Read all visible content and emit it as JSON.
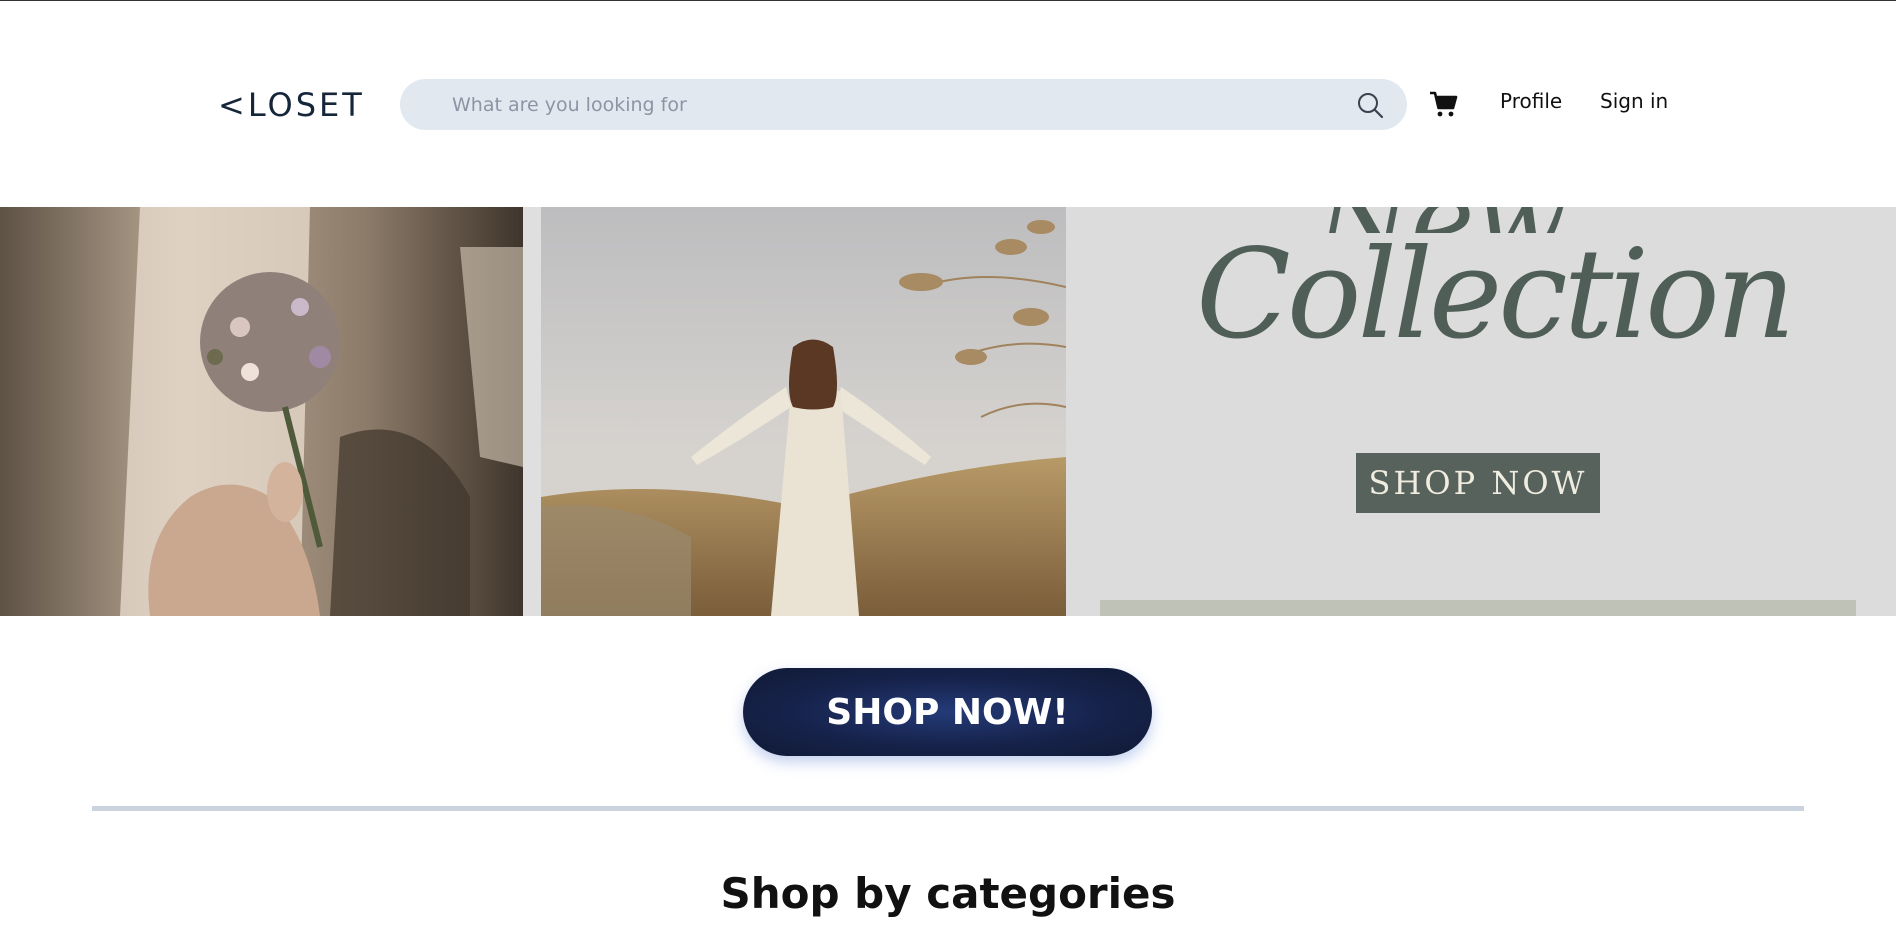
{
  "header": {
    "logo_text": "<LOSET",
    "search": {
      "placeholder": "What are you looking for",
      "value": ""
    },
    "cart_icon": "cart-icon",
    "nav": {
      "profile": "Profile",
      "sign_in": "Sign in"
    }
  },
  "hero": {
    "promo_title_line1": "New",
    "promo_title_line2": "Collection",
    "promo_button": "SHOP NOW"
  },
  "cta": {
    "label": "SHOP NOW!"
  },
  "section": {
    "title": "Shop by categories"
  },
  "colors": {
    "accent_dark": "#16224a",
    "search_bg": "#e2e8f0",
    "promo_green": "#56625b",
    "divider": "#cbd3df"
  }
}
